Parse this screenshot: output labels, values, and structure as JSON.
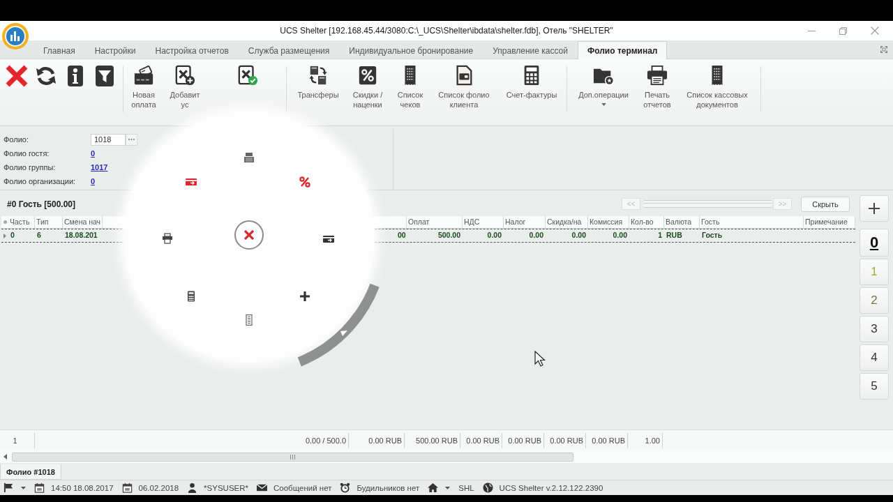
{
  "window": {
    "title": "UCS Shelter [192.168.45.44/3080:C:\\_UCS\\Shelter\\ibdata\\shelter.fdb], Отель \"SHELTER\""
  },
  "tabs": [
    {
      "label": "Главная",
      "selected": false
    },
    {
      "label": "Настройки",
      "selected": false
    },
    {
      "label": "Настройка отчетов",
      "selected": false
    },
    {
      "label": "Служба размещения",
      "selected": false
    },
    {
      "label": "Индивидуальное бронирование",
      "selected": false
    },
    {
      "label": "Управление кассой",
      "selected": false
    },
    {
      "label": "Фолио терминал",
      "selected": true
    }
  ],
  "ribbon": {
    "groups": [
      [
        {
          "kind": "icon",
          "dropdown": false
        },
        {
          "kind": "icon",
          "dropdown": false
        },
        {
          "kind": "icon",
          "dropdown": false
        },
        {
          "kind": "icon",
          "dropdown": false
        }
      ],
      [
        {
          "kind": "button",
          "label": "Новая\nоплата",
          "dropdown": false
        },
        {
          "kind": "button",
          "label": "Добавит\nус",
          "dropdown": false
        },
        {
          "kind": "icon",
          "dropdown": false
        }
      ],
      [
        {
          "kind": "button",
          "label": "Трансферы",
          "dropdown": false
        },
        {
          "kind": "button",
          "label": "Скидки /\nнаценки",
          "dropdown": false
        },
        {
          "kind": "button",
          "label": "Список\nчеков",
          "dropdown": false
        },
        {
          "kind": "button",
          "label": "Список фолио\nклиента",
          "dropdown": false
        },
        {
          "kind": "button",
          "label": "Счет-фактуры",
          "dropdown": false
        }
      ],
      [
        {
          "kind": "button",
          "label": "Доп.операции",
          "dropdown": true
        },
        {
          "kind": "button",
          "label": "Печать\nотчетов",
          "dropdown": false
        },
        {
          "kind": "button",
          "label": "Список кассовых\nдокументов",
          "dropdown": false
        }
      ]
    ]
  },
  "folio": {
    "fields": [
      {
        "label": "Фолио:",
        "kind": "input",
        "value": "1018"
      },
      {
        "label": "Фолио гостя:",
        "kind": "link",
        "value": "0"
      },
      {
        "label": "Фолио группы:",
        "kind": "link",
        "value": "1017"
      },
      {
        "label": "Фолио организации:",
        "kind": "link",
        "value": "0"
      }
    ]
  },
  "guest_folio": {
    "title": "#0 Гость [500.00]",
    "nav": [
      {
        "label": "<<",
        "disabled": true
      },
      {
        "label": ">>",
        "disabled": true
      }
    ],
    "hide_button": "Скрыть"
  },
  "table": {
    "left_columns": [
      "Часть",
      "Тип",
      "Смена нач"
    ],
    "right_columns": [
      "Оплат",
      "НДС",
      "Налог",
      "Скидка/на",
      "Комиссия",
      "Кол-во",
      "Валюта",
      "Гость",
      "Примечание"
    ],
    "rows": [
      {
        "selected": true,
        "left_cells": [
          "0",
          "6",
          "18.08.201"
        ],
        "right_cells": [
          "00",
          "500.00",
          "0.00",
          "0.00",
          "0.00",
          "0.00",
          "1",
          "RUB",
          "Гость"
        ]
      }
    ]
  },
  "parts": {
    "items": [
      {
        "label": "0",
        "selected": true,
        "color": "#111111"
      },
      {
        "label": "1",
        "selected": false,
        "color": "#9aab2e"
      },
      {
        "label": "2",
        "selected": false,
        "color": "#6f7650"
      },
      {
        "label": "3",
        "selected": false,
        "color": "#333333"
      },
      {
        "label": "4",
        "selected": false,
        "color": "#333333"
      },
      {
        "label": "5",
        "selected": false,
        "color": "#333333"
      }
    ]
  },
  "totals": [
    "1",
    "0.00 / 500.0",
    "0.00 RUB",
    "500.00 RUB",
    "0.00 RUB",
    "0.00 RUB",
    "0.00 RUB",
    "0.00 RUB",
    "1.00"
  ],
  "bottom_tabs": [
    {
      "label": "Фолио #1018",
      "selected": true
    }
  ],
  "status_bar": [
    {
      "dropdown": true
    },
    {
      "text": "14:50 18.08.2017",
      "dropdown": false
    },
    {
      "text": "06.02.2018",
      "dropdown": false
    },
    {
      "text": "*SYSUSER*",
      "dropdown": false
    },
    {
      "text": "Сообщений нет",
      "dropdown": false
    },
    {
      "text": "Будильников нет",
      "dropdown": false
    },
    {
      "dropdown": true
    },
    {
      "text": "SHL",
      "dropdown": false
    },
    {
      "text": "UCS Shelter v.2.12.122.2390",
      "dropdown": false
    }
  ]
}
